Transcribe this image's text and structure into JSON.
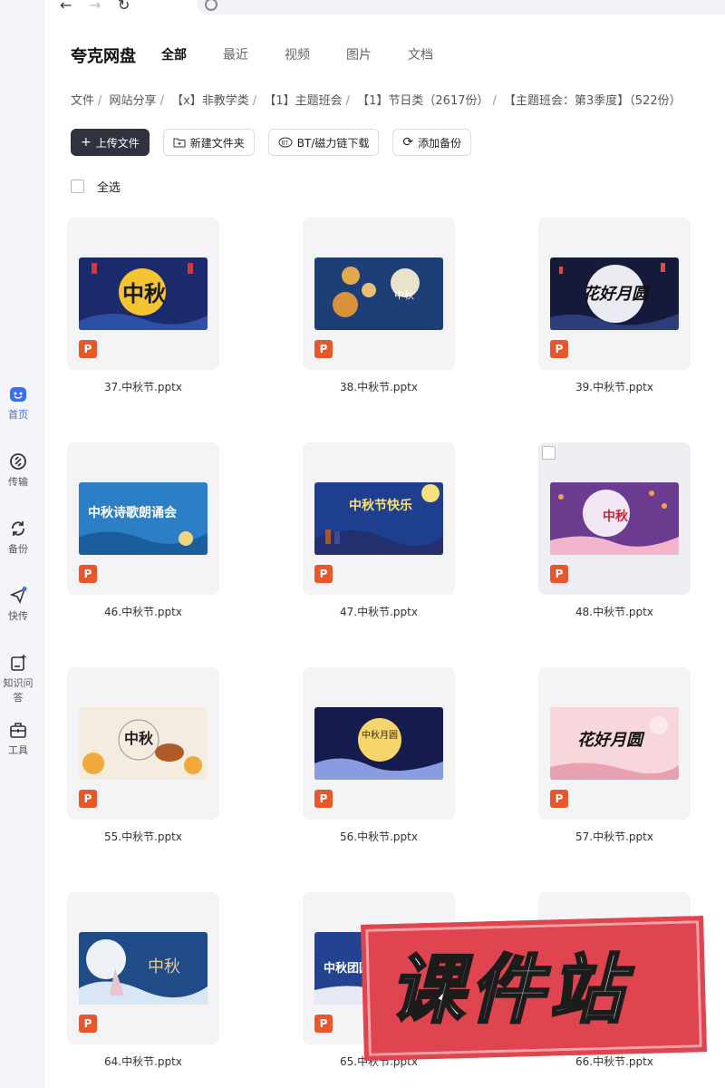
{
  "sidebar": {
    "items": [
      {
        "label": "首页",
        "icon": "home-icon",
        "active": true
      },
      {
        "label": "传输",
        "icon": "transfer-icon"
      },
      {
        "label": "备份",
        "icon": "backup-icon"
      },
      {
        "label": "快传",
        "icon": "quick-send-icon",
        "badge_dot": true
      },
      {
        "label": "知识问答",
        "icon": "knowledge-qa-icon"
      },
      {
        "label": "工具",
        "icon": "toolbox-icon"
      }
    ]
  },
  "header": {
    "brand": "夸克网盘",
    "tabs": [
      {
        "label": "全部",
        "active": true
      },
      {
        "label": "最近"
      },
      {
        "label": "视频"
      },
      {
        "label": "图片"
      },
      {
        "label": "文档"
      }
    ]
  },
  "breadcrumb": [
    "文件",
    "网站分享",
    "【x】非教学类",
    "【1】主题班会",
    "【1】节日类（2617份）",
    "【主题班会：第3季度】（522份）"
  ],
  "toolbar": {
    "upload": "上传文件",
    "new_folder": "新建文件夹",
    "bt_download": "BT/磁力链下载",
    "add_backup": "添加备份"
  },
  "select_all": "全选",
  "file_type_badge": "P",
  "files": [
    {
      "name": "37.中秋节.pptx",
      "thumb_text": "中秋"
    },
    {
      "name": "38.中秋节.pptx",
      "thumb_text": "中秋"
    },
    {
      "name": "39.中秋节.pptx",
      "thumb_text": "花好月圆"
    },
    {
      "name": "46.中秋节.pptx",
      "thumb_text": "中秋诗歌朗诵会"
    },
    {
      "name": "47.中秋节.pptx",
      "thumb_text": "中秋节快乐"
    },
    {
      "name": "48.中秋节.pptx",
      "thumb_text": "中秋"
    },
    {
      "name": "55.中秋节.pptx",
      "thumb_text": "中秋"
    },
    {
      "name": "56.中秋节.pptx",
      "thumb_text": "中秋月圆"
    },
    {
      "name": "57.中秋节.pptx",
      "thumb_text": "花好月圆"
    },
    {
      "name": "64.中秋节.pptx",
      "thumb_text": "中秋"
    },
    {
      "name": "65.中秋节.pptx",
      "thumb_text": "中秋团圆"
    },
    {
      "name": "66.中秋节.pptx",
      "thumb_text": ""
    }
  ],
  "watermark": "课件站",
  "colors": {
    "accent": "#3a6ff7",
    "ppt_badge": "#e8562a",
    "primary_button": "#2f3340",
    "watermark": "#e0444f"
  }
}
